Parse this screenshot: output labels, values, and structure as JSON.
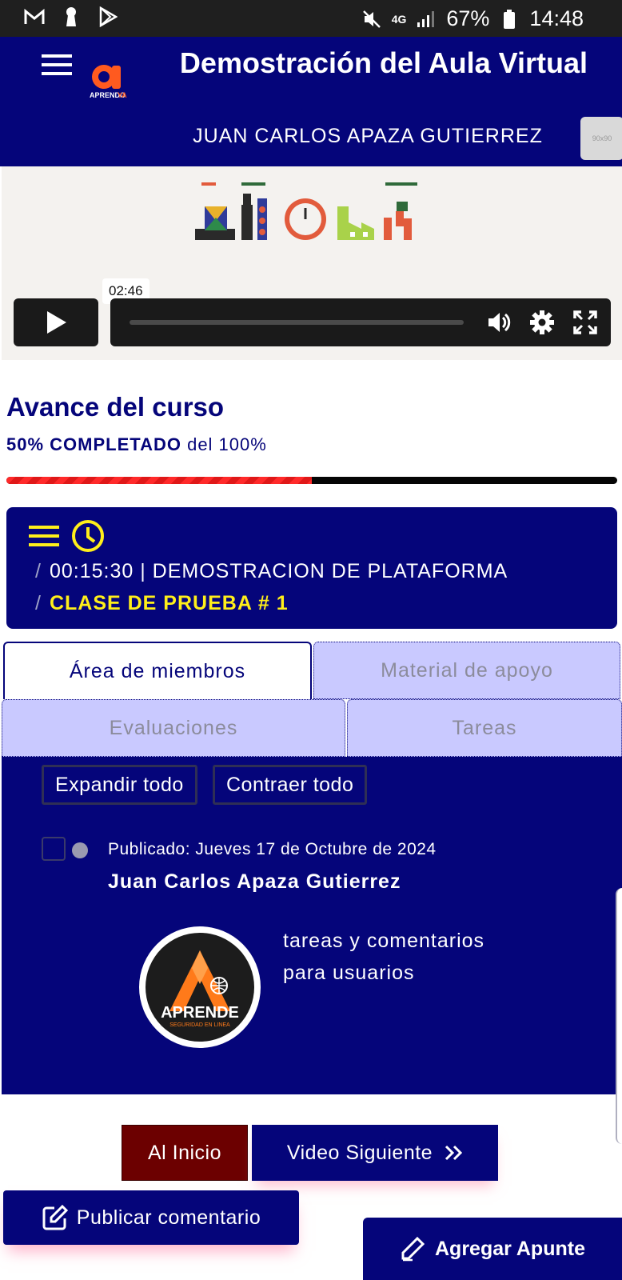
{
  "status_bar": {
    "battery": "67%",
    "time": "14:48",
    "network": "4G",
    "left_icons": [
      "gmail-icon",
      "keyhole-icon",
      "play-store-icon"
    ],
    "right_icons": [
      "mute-icon",
      "network-4g-icon",
      "signal-icon",
      "battery-icon"
    ]
  },
  "header": {
    "title": "Demostración del Aula Virtual",
    "user_name": "JUAN CARLOS APAZA GUTIERREZ",
    "logo_text": "APRENDO",
    "logo_accent": "YA",
    "avatar_placeholder": "90x90",
    "bg_color": "#05057a"
  },
  "video": {
    "time_tooltip": "02:46"
  },
  "progress": {
    "title": "Avance del curso",
    "percent_label": "50% COMPLETADO",
    "of_label": "del 100%",
    "fraction": 0.5
  },
  "lesson": {
    "line1": "00:15:30 | DEMOSTRACION DE PLATAFORMA",
    "line2": "CLASE DE PRUEBA # 1",
    "separator": "/"
  },
  "tabs": [
    {
      "label": "Área de miembros",
      "active": true
    },
    {
      "label": "Material de apoyo",
      "active": false
    },
    {
      "label": "Evaluaciones",
      "active": false
    },
    {
      "label": "Tareas",
      "active": false
    }
  ],
  "panel": {
    "expand_label": "Expandir todo",
    "collapse_label": "Contraer todo",
    "post": {
      "date": "Publicado: Jueves 17 de Octubre de 2024",
      "author": "Juan Carlos Apaza Gutierrez",
      "text_line1": "tareas y comentarios",
      "text_line2": "para usuarios",
      "logo_main": "APRENDE",
      "logo_tagline": "SEGURIDAD EN LINEA"
    }
  },
  "navigation": {
    "home_label": "Al Inicio",
    "next_label": "Video Siguiente"
  },
  "actions": {
    "comment_label": "Publicar comentario",
    "note_label": "Agregar Apunte"
  },
  "colors": {
    "primary": "#05057a",
    "accent_yellow": "#ffef1a",
    "home_button": "#6c0000",
    "progress_fill": "#ff2a2a",
    "tab_inactive": "#c9c9ff"
  }
}
